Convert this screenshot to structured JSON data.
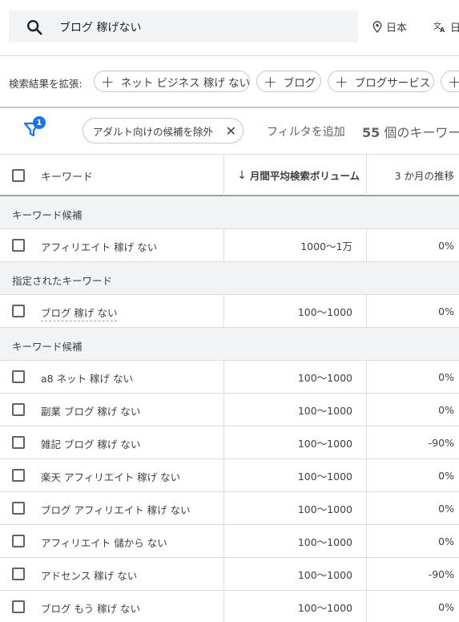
{
  "search": {
    "value": "ブログ 稼げない"
  },
  "location": {
    "label": "日本"
  },
  "language": {
    "label": "日"
  },
  "expand": {
    "label": "検索結果を拡張:",
    "chips": [
      "ネット ビジネス 稼げ ない",
      "ブログ",
      "ブログサービス",
      ""
    ]
  },
  "filters": {
    "badge_count": "1",
    "active_filter": "アダルト向けの候補を除外",
    "add_filter": "フィルタを追加",
    "count_number": "55",
    "count_text": " 個のキーワー"
  },
  "table": {
    "headers": {
      "keyword": "キーワード",
      "volume": "月間平均検索ボリューム",
      "trend": "3 か月の推移"
    },
    "groups": [
      {
        "title": "キーワード候補",
        "rows": [
          {
            "keyword": "アフィリエイト 稼げ ない",
            "volume": "1000～1万",
            "trend": "0%"
          }
        ]
      },
      {
        "title": "指定されたキーワード",
        "rows": [
          {
            "keyword": "ブログ 稼げ ない",
            "volume": "100～1000",
            "trend": "0%"
          }
        ]
      },
      {
        "title": "キーワード候補",
        "rows": [
          {
            "keyword": "a8 ネット 稼げ ない",
            "volume": "100～1000",
            "trend": "0%"
          },
          {
            "keyword": "副業 ブログ 稼げ ない",
            "volume": "100～1000",
            "trend": "0%"
          },
          {
            "keyword": "雑記 ブログ 稼げ ない",
            "volume": "100～1000",
            "trend": "-90%"
          },
          {
            "keyword": "楽天 アフィリエイト 稼げ ない",
            "volume": "100～1000",
            "trend": "0%"
          },
          {
            "keyword": "ブログ アフィリエイト 稼げ ない",
            "volume": "100～1000",
            "trend": "0%"
          },
          {
            "keyword": "アフィリエイト 儲から ない",
            "volume": "100～1000",
            "trend": "0%"
          },
          {
            "keyword": "アドセンス 稼げ ない",
            "volume": "100～1000",
            "trend": "-90%"
          },
          {
            "keyword": "ブログ もう 稼げ ない",
            "volume": "100～1000",
            "trend": "0%"
          }
        ]
      }
    ]
  }
}
